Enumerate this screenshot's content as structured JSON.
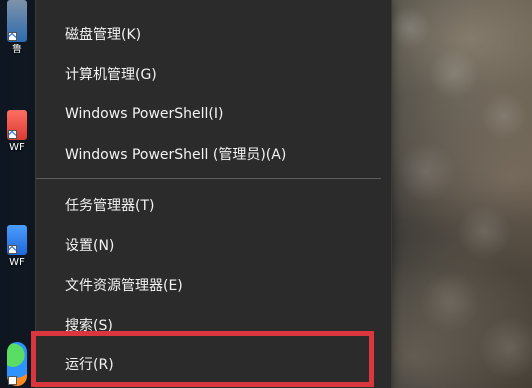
{
  "desktop": {
    "icons": [
      {
        "name": "desktop-shortcut-1",
        "label": "鲁"
      },
      {
        "name": "desktop-shortcut-2",
        "label": "WF"
      },
      {
        "name": "desktop-shortcut-3",
        "label": "WF"
      },
      {
        "name": "desktop-shortcut-4",
        "label": ""
      }
    ]
  },
  "context_menu": {
    "partial_item": "",
    "items": [
      {
        "label": "磁盘管理(K)"
      },
      {
        "label": "计算机管理(G)"
      },
      {
        "label": "Windows PowerShell(I)"
      },
      {
        "label": "Windows PowerShell (管理员)(A)"
      },
      {
        "label": "任务管理器(T)"
      },
      {
        "label": "设置(N)"
      },
      {
        "label": "文件资源管理器(E)"
      },
      {
        "label": "搜索(S)"
      },
      {
        "label": "运行(R)"
      }
    ]
  },
  "colors": {
    "menu_background": "#2b2b2b",
    "menu_text": "#f3f3f3",
    "highlight": "#d9363e"
  }
}
